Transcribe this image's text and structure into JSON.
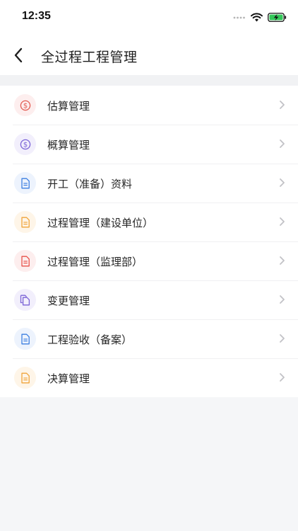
{
  "status": {
    "time": "12:35"
  },
  "nav": {
    "title": "全过程工程管理"
  },
  "menu": [
    {
      "label": "估算管理",
      "icon": "dollar-circle-icon",
      "color": "#e25c52",
      "bg": "#fdeeee"
    },
    {
      "label": "概算管理",
      "icon": "dollar-circle-icon",
      "color": "#7b63d6",
      "bg": "#f2effc"
    },
    {
      "label": "开工（准备）资料",
      "icon": "document-icon",
      "color": "#3d7fe0",
      "bg": "#edf3fd"
    },
    {
      "label": "过程管理（建设单位）",
      "icon": "document-icon",
      "color": "#f0a43a",
      "bg": "#fef5e8"
    },
    {
      "label": "过程管理（监理部）",
      "icon": "document-icon",
      "color": "#e8524a",
      "bg": "#fdeeee"
    },
    {
      "label": "变更管理",
      "icon": "copy-document-icon",
      "color": "#7b63d6",
      "bg": "#f2effc"
    },
    {
      "label": "工程验收（备案）",
      "icon": "document-icon",
      "color": "#3d7fe0",
      "bg": "#edf3fd"
    },
    {
      "label": "决算管理",
      "icon": "document-icon",
      "color": "#f0a43a",
      "bg": "#fef5e8"
    }
  ]
}
